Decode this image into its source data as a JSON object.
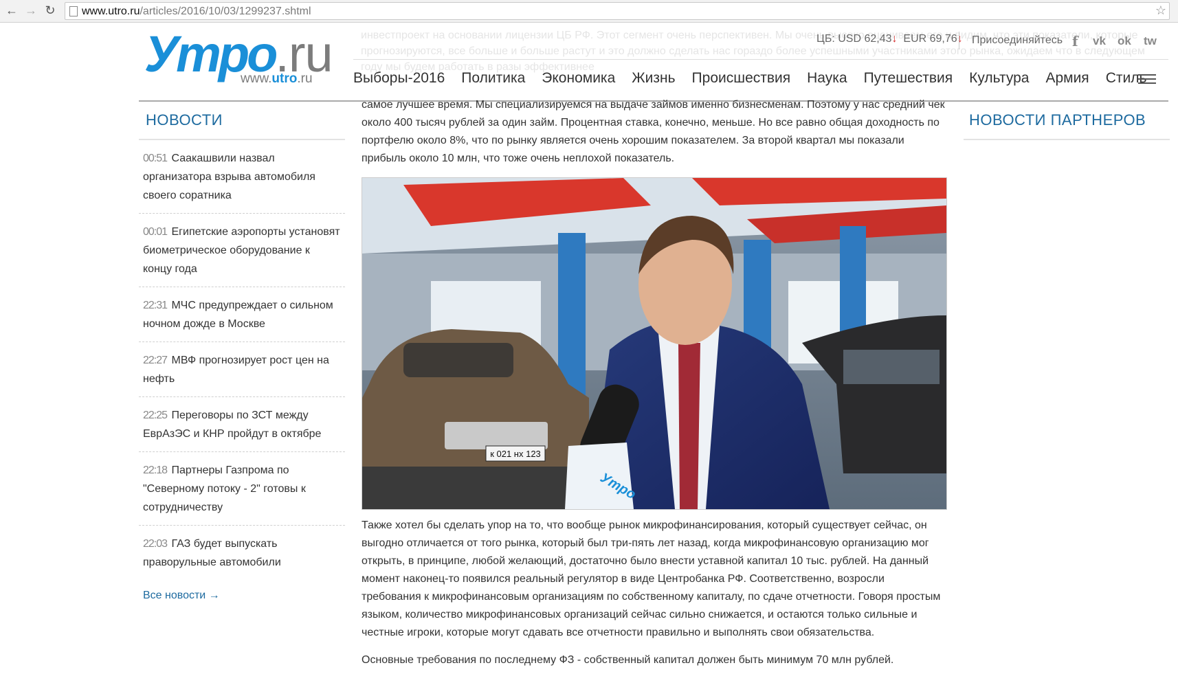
{
  "browser": {
    "back_icon": "back-arrow-icon",
    "forward_icon": "forward-arrow-icon",
    "reload_icon": "reload-icon",
    "url_host": "www.utro.ru",
    "url_path": "/articles/2016/10/03/1299237.shtml"
  },
  "logo": {
    "main": "Утро",
    "suffix": ".ru",
    "sub_prefix": "www.",
    "sub_brand": "utro",
    "sub_suffix": ".ru"
  },
  "header": {
    "currency_usd": "ЦБ: USD 62,43",
    "currency_eur": "EUR 69,76",
    "arrow": "↓",
    "join": "Присоединяйтесь",
    "social": [
      "f",
      "vk",
      "ok",
      "tw"
    ],
    "ghost_text": "инвестпроект на основании лицензии ЦБ РФ. Этот сегмент очень перспективен. Мы очень высоко оцениваем его и видим, что эти показатели, которые прогнозируются, все больше и больше растут и это должно сделать нас гораздо более успешными участниками этого рынка, ожидаем что в следующем году мы будем работать в разы эффективнее"
  },
  "menu": [
    "Выборы-2016",
    "Политика",
    "Экономика",
    "Жизнь",
    "Происшествия",
    "Наука",
    "Путешествия",
    "Культура",
    "Армия",
    "Стиль"
  ],
  "news": {
    "title": "НОВОСТИ",
    "items": [
      {
        "time": "00:51",
        "text": "Саакашвили назвал организатора взрыва автомобиля своего соратника"
      },
      {
        "time": "00:01",
        "text": "Египетские аэропорты установят биометрическое оборудование к концу года"
      },
      {
        "time": "22:31",
        "text": "МЧС предупреждает о сильном ночном дожде в Москве"
      },
      {
        "time": "22:27",
        "text": "МВФ прогнозирует рост цен на нефть"
      },
      {
        "time": "22:25",
        "text": "Переговоры по ЗСТ между ЕврАзЭС и КНР пройдут в октябре"
      },
      {
        "time": "22:18",
        "text": "Партнеры Газпрома по \"Северному потоку - 2\" готовы к сотрудничеству"
      },
      {
        "time": "22:03",
        "text": "ГАЗ будет выпускать праворульные автомобили"
      }
    ],
    "all_link": "Все новости →"
  },
  "article": {
    "para1": "самое лучшее время. Мы специализируемся на выдаче займов именно бизнесменам. Поэтому у нас средний чек около 400 тысяч рублей за один займ. Процентная ставка, конечно, меньше. Но все равно общая доходность по портфелю около 8%, что по рынку является очень хорошим показателем. За второй квартал мы показали прибыль около 10 млн, что тоже очень неплохой показатель.",
    "photo_plate": "к 021 нх 123",
    "photo_mic_label": "Утро",
    "para2": "Также хотел бы сделать упор на то, что вообще рынок микрофинансирования, который существует сейчас, он выгодно отличается от того рынка, который был три-пять лет назад, когда микрофинансовую организацию мог открыть, в принципе, любой желающий, достаточно было внести уставной капитал 10 тыс. рублей. На данный момент наконец-то появился реальный регулятор в виде Центробанка РФ. Соответственно, возросли требования к микрофинансовым организациям по собственному капиталу, по сдаче отчетности. Говоря простым языком, количество микрофинансовых организаций сейчас сильно снижается, и остаются только сильные и честные игроки, которые могут сдавать все отчетности правильно и выполнять свои обязательства.",
    "para3": "Основные требования по последнему ФЗ - собственный капитал должен быть минимум 70 млн рублей."
  },
  "partners": {
    "title": "НОВОСТИ ПАРТНЕРОВ"
  }
}
